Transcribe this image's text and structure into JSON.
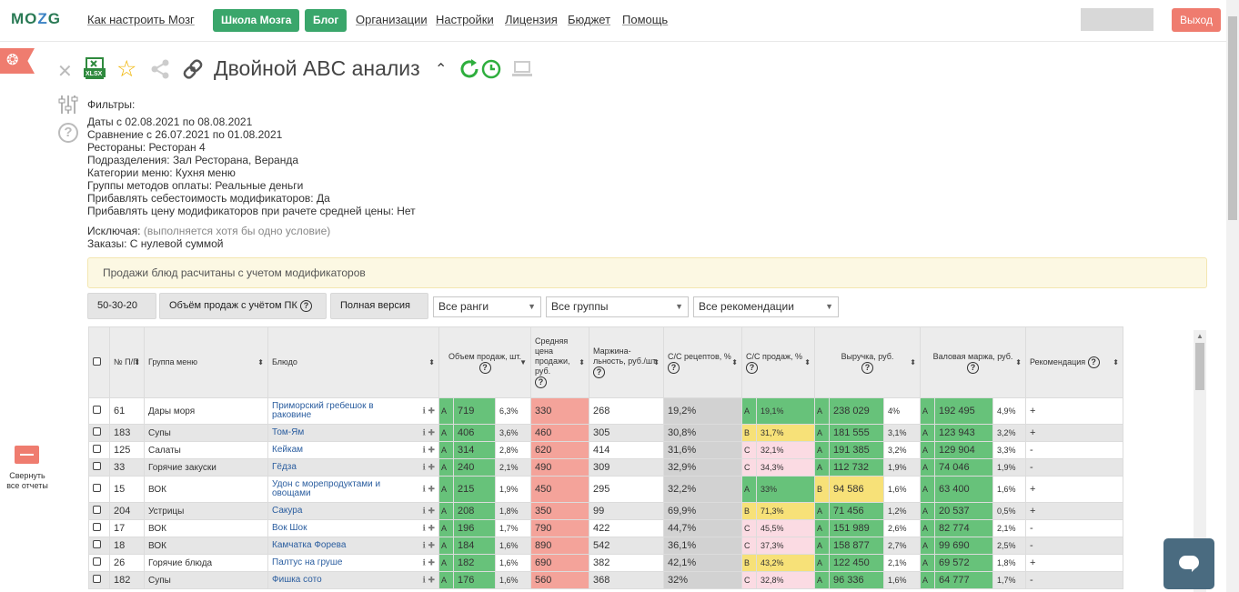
{
  "header": {
    "logo": "MOZG",
    "nav": [
      {
        "label": "Как настроить Мозг"
      },
      {
        "label": "Школа Мозга"
      },
      {
        "label": "Блог"
      },
      {
        "label": "Организации"
      },
      {
        "label": "Настройки"
      },
      {
        "label": "Лицензия"
      },
      {
        "label": "Бюджет"
      },
      {
        "label": "Помощь"
      }
    ],
    "exit": "Выход"
  },
  "sidebar": {
    "collapse_label": "Свернуть все отчеты"
  },
  "report": {
    "title": "Двойной ABC анализ",
    "xlsx": "XLSX"
  },
  "filters": {
    "heading": "Фильтры:",
    "lines": [
      "Даты с 02.08.2021 по 08.08.2021",
      "Сравнение с 26.07.2021 по 01.08.2021",
      "Рестораны: Ресторан 4",
      "Подразделения: Зал Ресторана, Веранда",
      "Категории меню: Кухня меню",
      "Группы методов оплаты: Реальные деньги",
      "Прибавлять себестоимость модификаторов: Да",
      "Прибавлять цену модификаторов при рачете средней цены: Нет"
    ],
    "exclude_label": "Исключая:",
    "exclude_note": "(выполняется хотя бы одно условие)",
    "exclude_orders": "Заказы: С нулевой суммой"
  },
  "notice": "Продажи блюд расчитаны с учетом модификаторов",
  "toolbar": {
    "ratio": "50-30-20",
    "volume": "Объём продаж с учётом ПК",
    "version": "Полная версия",
    "ranks": "Все ранги",
    "groups": "Все группы",
    "recs": "Все рекомендации"
  },
  "table": {
    "headers": {
      "num": "№ П/П",
      "group": "Группа меню",
      "dish": "Блюдо",
      "volume": "Объем продаж, шт.",
      "avg_price": "Средняя цена продажи, руб.",
      "margin": "Маржина-льность, руб./шт.",
      "cost_recipe": "С/С рецептов, %",
      "cost_sales": "С/С продаж, %",
      "revenue": "Выручка, руб.",
      "gross_margin": "Валовая маржа, руб.",
      "recommendation": "Рекомендация"
    },
    "rows": [
      {
        "num": "61",
        "group": "Дары моря",
        "dish": "Приморский гребешок в раковине",
        "vol_rank": "A",
        "vol": "719",
        "vol_pct": "6,3%",
        "price": "330",
        "margin": "268",
        "cost_recipe": "19,2%",
        "cs_rank": "A",
        "cs": "19,1%",
        "rev_rank": "A",
        "rev": "238 029",
        "rev_pct": "4%",
        "gm_rank": "A",
        "gm": "192 495",
        "gm_pct": "4,9%",
        "rec": "+"
      },
      {
        "num": "183",
        "group": "Супы",
        "dish": "Том-Ям",
        "vol_rank": "A",
        "vol": "406",
        "vol_pct": "3,6%",
        "price": "460",
        "margin": "305",
        "cost_recipe": "30,8%",
        "cs_rank": "B",
        "cs": "31,7%",
        "rev_rank": "A",
        "rev": "181 555",
        "rev_pct": "3,1%",
        "gm_rank": "A",
        "gm": "123 943",
        "gm_pct": "3,2%",
        "rec": "+"
      },
      {
        "num": "125",
        "group": "Салаты",
        "dish": "Кейкам",
        "vol_rank": "A",
        "vol": "314",
        "vol_pct": "2,8%",
        "price": "620",
        "margin": "414",
        "cost_recipe": "31,6%",
        "cs_rank": "C",
        "cs": "32,1%",
        "rev_rank": "A",
        "rev": "191 385",
        "rev_pct": "3,2%",
        "gm_rank": "A",
        "gm": "129 904",
        "gm_pct": "3,3%",
        "rec": "-"
      },
      {
        "num": "33",
        "group": "Горячие закуски",
        "dish": "Гёдза",
        "vol_rank": "A",
        "vol": "240",
        "vol_pct": "2,1%",
        "price": "490",
        "margin": "309",
        "cost_recipe": "32,9%",
        "cs_rank": "C",
        "cs": "34,3%",
        "rev_rank": "A",
        "rev": "112 732",
        "rev_pct": "1,9%",
        "gm_rank": "A",
        "gm": "74 046",
        "gm_pct": "1,9%",
        "rec": "-"
      },
      {
        "num": "15",
        "group": "ВОК",
        "dish": "Удон с морепродуктами и овощами",
        "vol_rank": "A",
        "vol": "215",
        "vol_pct": "1,9%",
        "price": "450",
        "margin": "295",
        "cost_recipe": "32,2%",
        "cs_rank": "A",
        "cs": "33%",
        "rev_rank": "B",
        "rev": "94 586",
        "rev_pct": "1,6%",
        "gm_rank": "A",
        "gm": "63 400",
        "gm_pct": "1,6%",
        "rec": "+"
      },
      {
        "num": "204",
        "group": "Устрицы",
        "dish": "Сакура",
        "vol_rank": "A",
        "vol": "208",
        "vol_pct": "1,8%",
        "price": "350",
        "margin": "99",
        "cost_recipe": "69,9%",
        "cs_rank": "B",
        "cs": "71,3%",
        "rev_rank": "A",
        "rev": "71 456",
        "rev_pct": "1,2%",
        "gm_rank": "A",
        "gm": "20 537",
        "gm_pct": "0,5%",
        "rec": "+"
      },
      {
        "num": "17",
        "group": "ВОК",
        "dish": "Вок Шок",
        "vol_rank": "A",
        "vol": "196",
        "vol_pct": "1,7%",
        "price": "790",
        "margin": "422",
        "cost_recipe": "44,7%",
        "cs_rank": "C",
        "cs": "45,5%",
        "rev_rank": "A",
        "rev": "151 989",
        "rev_pct": "2,6%",
        "gm_rank": "A",
        "gm": "82 774",
        "gm_pct": "2,1%",
        "rec": "-"
      },
      {
        "num": "18",
        "group": "ВОК",
        "dish": "Камчатка Форева",
        "vol_rank": "A",
        "vol": "184",
        "vol_pct": "1,6%",
        "price": "890",
        "margin": "542",
        "cost_recipe": "36,1%",
        "cs_rank": "C",
        "cs": "37,3%",
        "rev_rank": "A",
        "rev": "158 877",
        "rev_pct": "2,7%",
        "gm_rank": "A",
        "gm": "99 690",
        "gm_pct": "2,5%",
        "rec": "-"
      },
      {
        "num": "26",
        "group": "Горячие блюда",
        "dish": "Палтус на груше",
        "vol_rank": "A",
        "vol": "182",
        "vol_pct": "1,6%",
        "price": "690",
        "margin": "382",
        "cost_recipe": "42,1%",
        "cs_rank": "B",
        "cs": "43,2%",
        "rev_rank": "A",
        "rev": "122 450",
        "rev_pct": "2,1%",
        "gm_rank": "A",
        "gm": "69 572",
        "gm_pct": "1,8%",
        "rec": "+"
      },
      {
        "num": "182",
        "group": "Супы",
        "dish": "Фишка сото",
        "vol_rank": "A",
        "vol": "176",
        "vol_pct": "1,6%",
        "price": "560",
        "margin": "368",
        "cost_recipe": "32%",
        "cs_rank": "C",
        "cs": "32,8%",
        "rev_rank": "A",
        "rev": "96 336",
        "rev_pct": "1,6%",
        "gm_rank": "A",
        "gm": "64 777",
        "gm_pct": "1,7%",
        "rec": "-"
      }
    ]
  }
}
